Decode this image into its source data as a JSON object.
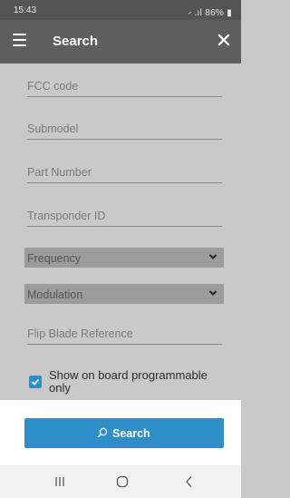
{
  "status_bar": {
    "time": "15:43",
    "indicators": "⹝ .ıl 86% ▮",
    "battery": "86%"
  },
  "app_bar": {
    "title": "Search",
    "menu_icon": "hamburger-menu-icon",
    "close_icon": "close-icon"
  },
  "form": {
    "fcc_code": {
      "placeholder": "FCC code",
      "value": ""
    },
    "submodel": {
      "placeholder": "Submodel",
      "value": ""
    },
    "part_number": {
      "placeholder": "Part Number",
      "value": ""
    },
    "transponder_id": {
      "placeholder": "Transponder ID",
      "value": ""
    },
    "frequency": {
      "selected": "Frequency",
      "icon": "chevron-down-icon"
    },
    "modulation": {
      "selected": "Modulation",
      "icon": "chevron-down-icon"
    },
    "flip_blade_reference": {
      "placeholder": "Flip Blade Reference",
      "value": ""
    },
    "on_board_checkbox": {
      "label": "Show on board programmable only",
      "checked": true
    }
  },
  "search_button": {
    "label": "Search",
    "icon": "search-icon"
  },
  "nav_bar": {
    "recents_icon": "recents-icon",
    "home_icon": "home-icon",
    "back_icon": "back-icon"
  },
  "colors": {
    "accent": "#2d8fc7",
    "app_bar": "#5e5e5e",
    "status_bar": "#545454",
    "form_background": "#c9c9c9",
    "select_background": "#9c9c9c"
  }
}
